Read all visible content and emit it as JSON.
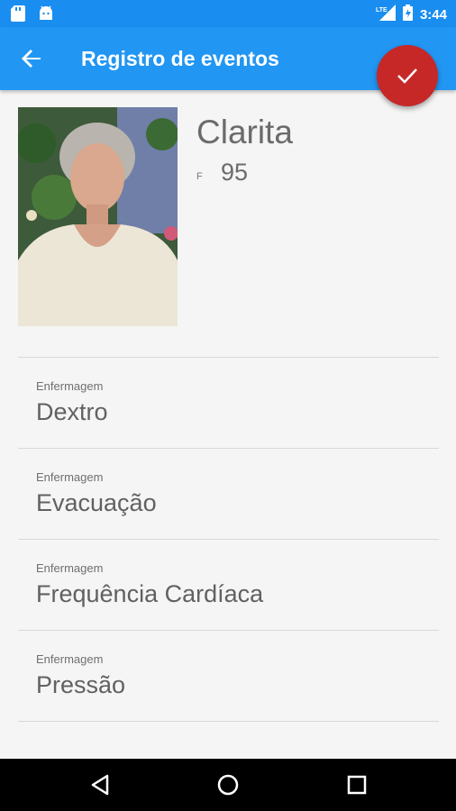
{
  "status": {
    "time": "3:44",
    "network": "LTE"
  },
  "toolbar": {
    "title": "Registro de eventos"
  },
  "profile": {
    "name": "Clarita",
    "sex": "F",
    "age": "95"
  },
  "events": [
    {
      "category": "Enfermagem",
      "label": "Dextro"
    },
    {
      "category": "Enfermagem",
      "label": "Evacuação"
    },
    {
      "category": "Enfermagem",
      "label": "Frequência Cardíaca"
    },
    {
      "category": "Enfermagem",
      "label": "Pressão"
    }
  ]
}
